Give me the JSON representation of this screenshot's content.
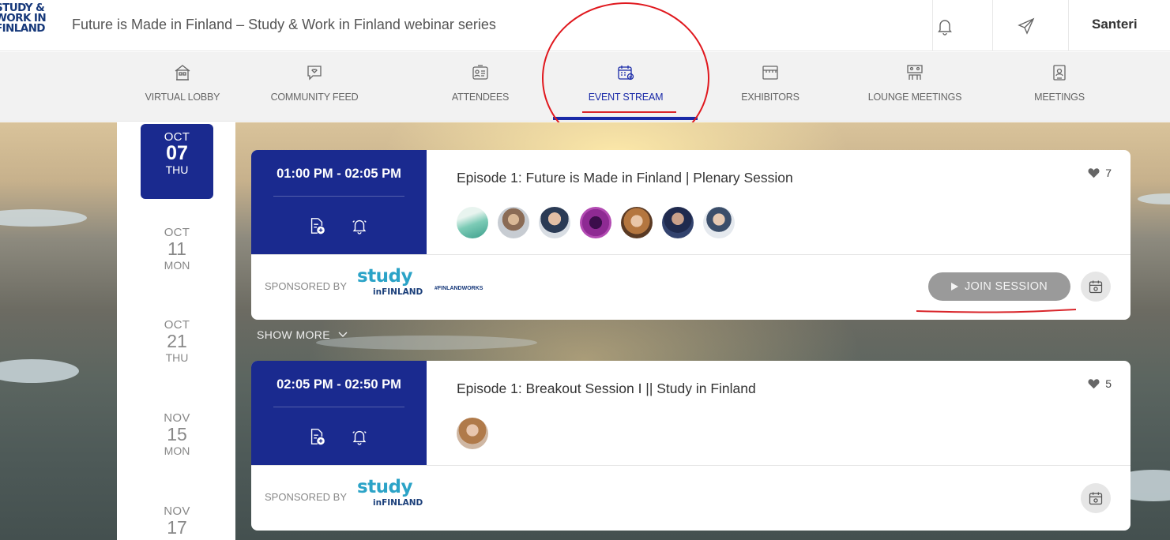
{
  "header": {
    "logo_lines": [
      "STUDY &",
      "WORK IN",
      "FINLAND"
    ],
    "title": "Future is Made in Finland – Study & Work in Finland webinar series",
    "user_name": "Santeri"
  },
  "nav": {
    "items": [
      {
        "label": "VIRTUAL LOBBY",
        "icon": "lobby-icon"
      },
      {
        "label": "COMMUNITY FEED",
        "icon": "chat-bubble-icon"
      },
      {
        "label": "ATTENDEES",
        "icon": "attendees-icon"
      },
      {
        "label": "EVENT STREAM",
        "icon": "event-calendar-icon",
        "active": true
      },
      {
        "label": "EXHIBITORS",
        "icon": "booth-icon"
      },
      {
        "label": "LOUNGE MEETINGS",
        "icon": "lounge-icon"
      },
      {
        "label": "MEETINGS",
        "icon": "meeting-badge-icon"
      }
    ]
  },
  "dates": [
    {
      "month": "OCT",
      "day": "07",
      "weekday": "THU",
      "selected": true
    },
    {
      "month": "OCT",
      "day": "11",
      "weekday": "MON"
    },
    {
      "month": "OCT",
      "day": "21",
      "weekday": "THU"
    },
    {
      "month": "NOV",
      "day": "15",
      "weekday": "MON"
    },
    {
      "month": "NOV",
      "day": "17",
      "weekday": ""
    }
  ],
  "sessions": [
    {
      "time": "01:00 PM - 02:05 PM",
      "title": "Episode 1: Future is Made in Finland | Plenary Session",
      "likes": "7",
      "sponsored_label": "SPONSORED BY",
      "sponsor_logo": {
        "word": "study",
        "sub": "inFINLAND"
      },
      "extra_logo": "#FINLANDWORKS",
      "join_label": "JOIN SESSION"
    },
    {
      "time": "02:05 PM - 02:50 PM",
      "title": "Episode 1: Breakout Session I || Study in Finland",
      "likes": "5",
      "sponsored_label": "SPONSORED BY",
      "sponsor_logo": {
        "word": "study",
        "sub": "inFINLAND"
      }
    }
  ],
  "show_more": "SHOW MORE",
  "colors": {
    "accent": "#1a2a8f",
    "annotation": "#e0181e",
    "join_button": "#9a9a9a"
  }
}
